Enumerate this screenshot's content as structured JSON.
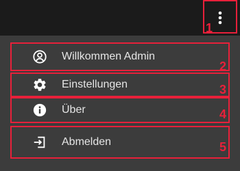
{
  "menu_button": {
    "icon": "more-vert-icon",
    "marker": "1"
  },
  "menu": {
    "items": [
      {
        "icon": "account-circle-icon",
        "label": "Willkommen Admin",
        "marker": "2"
      },
      {
        "icon": "gear-icon",
        "label": "Einstellungen",
        "marker": "3"
      },
      {
        "icon": "info-icon",
        "label": "Über",
        "marker": "4"
      },
      {
        "icon": "logout-icon",
        "label": "Abmelden",
        "marker": "5"
      }
    ]
  },
  "colors": {
    "topbar": "#1b1b1b",
    "menu": "#3c3c3c",
    "highlight": "#e8203a",
    "text": "#e6e6e6"
  }
}
